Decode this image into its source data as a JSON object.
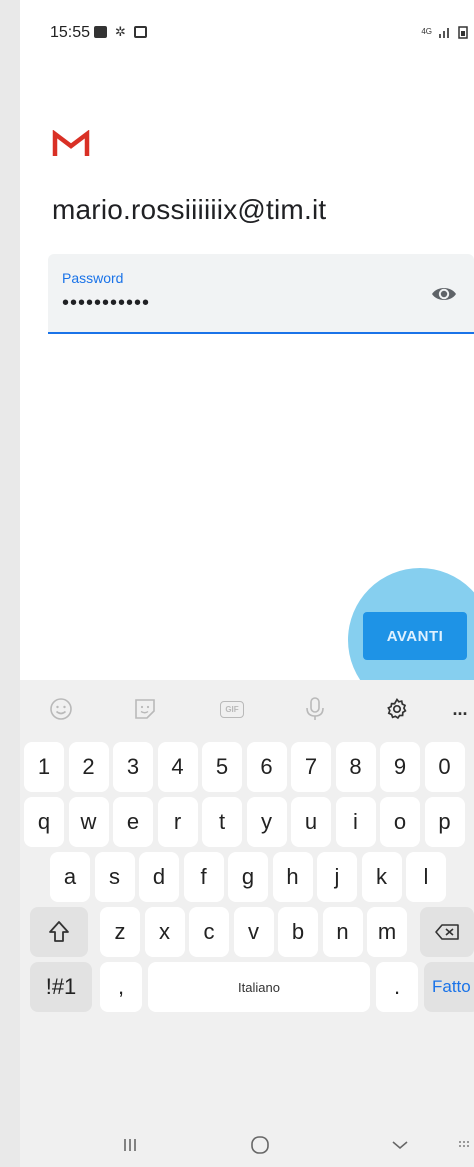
{
  "status_bar": {
    "time": "15:55",
    "network": "4G"
  },
  "account": {
    "email": "mario.rossiiiiiix@tim.it"
  },
  "password_field": {
    "label": "Password",
    "value": "•••••••••••"
  },
  "next_button": {
    "label": "AVANTI"
  },
  "keyboard": {
    "toolbar_gif": "GIF",
    "toolbar_more": "...",
    "number_row": [
      "1",
      "2",
      "3",
      "4",
      "5",
      "6",
      "7",
      "8",
      "9",
      "0"
    ],
    "row1": [
      "q",
      "w",
      "e",
      "r",
      "t",
      "y",
      "u",
      "i",
      "o",
      "p"
    ],
    "row2": [
      "a",
      "s",
      "d",
      "f",
      "g",
      "h",
      "j",
      "k",
      "l"
    ],
    "row3": [
      "z",
      "x",
      "c",
      "v",
      "b",
      "n",
      "m"
    ],
    "symbols_key": "!#1",
    "comma_key": ",",
    "space_label": "Italiano",
    "period_key": ".",
    "done_key": "Fatto"
  },
  "colors": {
    "accent": "#1a73e8",
    "button": "#1e93e6",
    "gmail_red": "#d93025",
    "highlight": "#7ccbee"
  }
}
